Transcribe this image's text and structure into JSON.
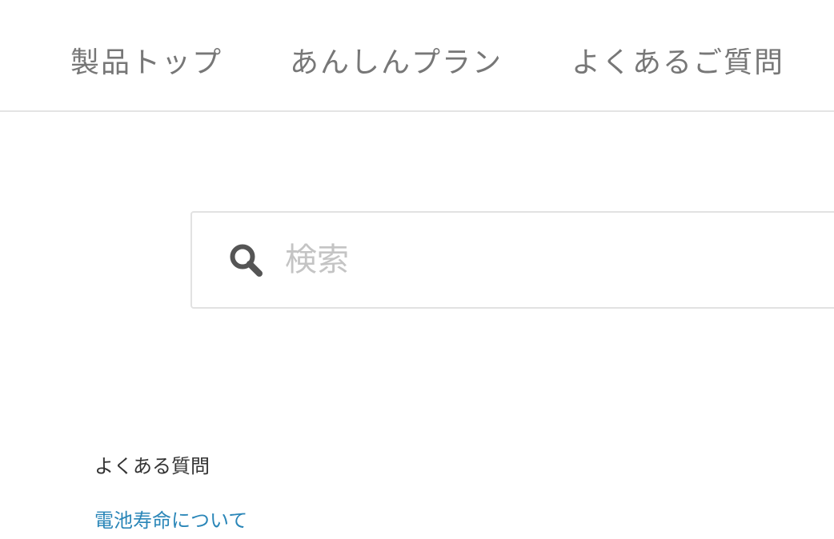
{
  "nav": {
    "items": [
      {
        "label": "製品トップ"
      },
      {
        "label": "あんしんプラン"
      },
      {
        "label": "よくあるご質問"
      }
    ]
  },
  "search": {
    "placeholder": "検索",
    "value": "",
    "icon": "search-icon"
  },
  "faq": {
    "title": "よくある質問",
    "links": [
      {
        "label": "電池寿命について"
      }
    ]
  },
  "colors": {
    "nav_text": "#777777",
    "divider": "#e4e4e4",
    "search_border": "#e2e2e2",
    "placeholder": "#c4c4c4",
    "icon": "#555555",
    "link": "#2a86b8",
    "heading": "#333333"
  }
}
